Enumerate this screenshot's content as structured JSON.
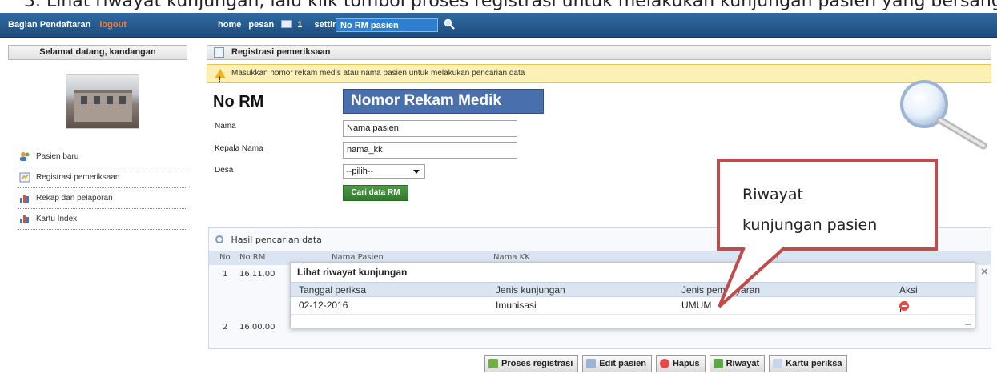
{
  "top_stripe": {
    "text": "3. Lihat riwayat kunjungan, lalu klik tombol proses registrasi untuk melakukan kunjungan pasien yang bersangkutan"
  },
  "navbar": {
    "role": "Bagian Pendaftaran",
    "logout": "logout",
    "links": {
      "home": "home",
      "pesan": "pesan",
      "pesan_count": "1",
      "setting": "setting"
    },
    "search_value": "No RM pasien"
  },
  "sidebar": {
    "welcome": "Selamat datang, kandangan",
    "items": [
      {
        "label": "Pasien baru",
        "icon": "users-icon"
      },
      {
        "label": "Registrasi pemeriksaan",
        "icon": "register-icon"
      },
      {
        "label": "Rekap dan pelaporan",
        "icon": "chart-icon"
      },
      {
        "label": "Kartu Index",
        "icon": "chart-icon"
      }
    ]
  },
  "main": {
    "title": "Registrasi pemeriksaan",
    "alert": "Masukkan nomor rekam medis atau nama pasien untuk melakukan pencarian data",
    "norm_label": "No RM",
    "norm_value": "Nomor Rekam Medik",
    "fields": {
      "nama": {
        "label": "Nama",
        "value": "Nama pasien"
      },
      "kepala_nama": {
        "label": "Kepala Nama",
        "value": "nama_kk"
      },
      "desa": {
        "label": "Desa",
        "value": "--pilih--"
      }
    },
    "search_button": "Cari data RM"
  },
  "callout": {
    "line1": "Riwayat",
    "line2": "kunjungan pasien"
  },
  "results": {
    "title": "Hasil pencarian data",
    "columns": [
      "No",
      "No RM",
      "Nama Pasien",
      "Nama KK",
      "Nam"
    ],
    "rows": [
      {
        "no": "1",
        "norm": "16.11.00"
      },
      {
        "no": "2",
        "norm": "16.00.00"
      }
    ],
    "actions": [
      "Proses registrasi",
      "Edit pasien",
      "Hapus",
      "Riwayat",
      "Kartu periksa"
    ]
  },
  "modal": {
    "title": "Lihat riwayat kunjungan",
    "columns": [
      "Tanggal periksa",
      "Jenis kunjungan",
      "Jenis pembayaran",
      "Aksi"
    ],
    "rows": [
      {
        "tanggal": "02-12-2016",
        "jenis_kunjungan": "Imunisasi",
        "jenis_pembayaran": "UMUM",
        "separator": "|"
      }
    ],
    "close": "×"
  },
  "colors": {
    "nav_bg": "#1d4d7e",
    "logout": "#ff7a2f",
    "callout_border": "#bf4b4b",
    "alert_bg": "#fdf0b4"
  }
}
